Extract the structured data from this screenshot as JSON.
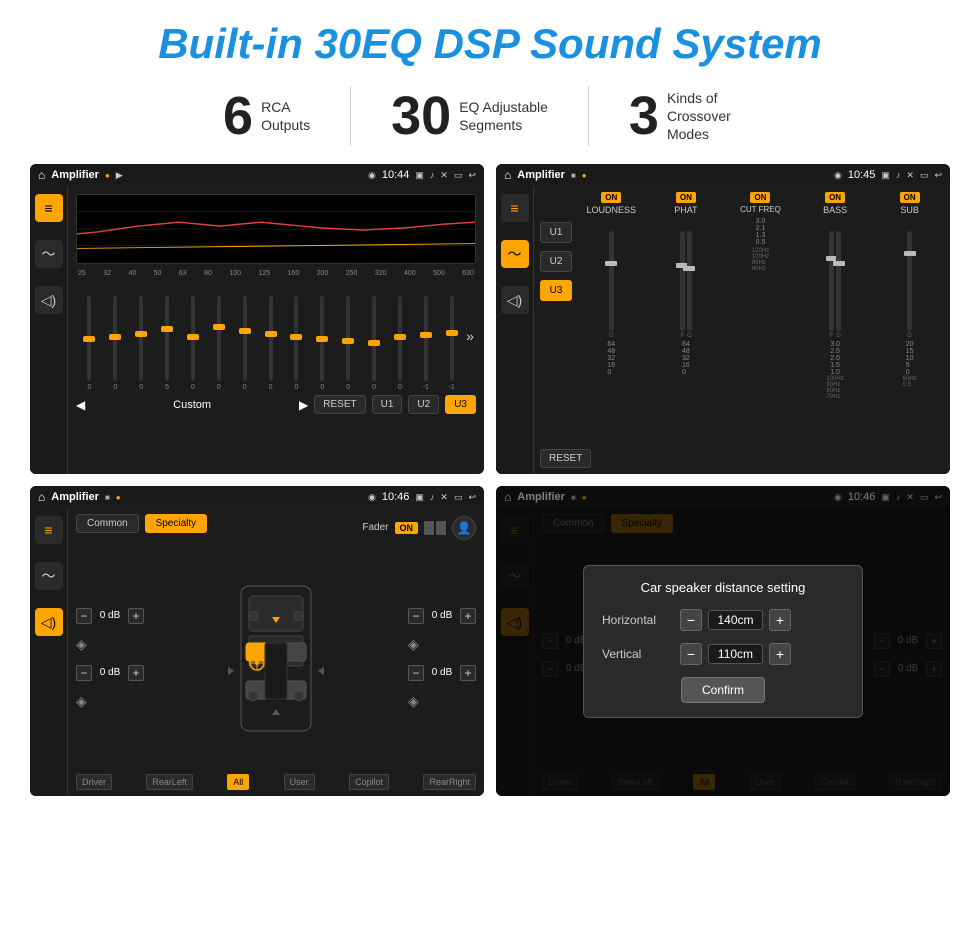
{
  "page": {
    "title": "Built-in 30EQ DSP Sound System",
    "stats": [
      {
        "number": "6",
        "text_line1": "RCA",
        "text_line2": "Outputs"
      },
      {
        "number": "30",
        "text_line1": "EQ Adjustable",
        "text_line2": "Segments"
      },
      {
        "number": "3",
        "text_line1": "Kinds of",
        "text_line2": "Crossover Modes"
      }
    ]
  },
  "screens": {
    "eq": {
      "topbar": {
        "title": "Amplifier",
        "time": "10:44"
      },
      "freq_labels": [
        "25",
        "32",
        "40",
        "50",
        "63",
        "80",
        "100",
        "125",
        "160",
        "200",
        "250",
        "320",
        "400",
        "500",
        "630"
      ],
      "preset_label": "Custom",
      "buttons": [
        "RESET",
        "U1",
        "U2",
        "U3"
      ]
    },
    "dsp": {
      "topbar": {
        "title": "Amplifier",
        "time": "10:45"
      },
      "presets": [
        "U1",
        "U2",
        "U3"
      ],
      "active_preset": "U3",
      "channels": [
        {
          "name": "LOUDNESS",
          "on": true
        },
        {
          "name": "PHAT",
          "on": true
        },
        {
          "name": "CUT FREQ",
          "on": true
        },
        {
          "name": "BASS",
          "on": true
        },
        {
          "name": "SUB",
          "on": true
        }
      ],
      "reset_label": "RESET"
    },
    "fader": {
      "topbar": {
        "title": "Amplifier",
        "time": "10:46"
      },
      "tabs": [
        "Common",
        "Specialty"
      ],
      "active_tab": "Specialty",
      "fader_label": "Fader",
      "on_badge": "ON",
      "db_values": [
        "0 dB",
        "0 dB",
        "0 dB",
        "0 dB"
      ],
      "position_labels": [
        "Driver",
        "RearLeft",
        "All",
        "User",
        "Copilot",
        "RearRight"
      ]
    },
    "dialog": {
      "topbar": {
        "title": "Amplifier",
        "time": "10:46"
      },
      "tabs": [
        "Common",
        "Specialty"
      ],
      "active_tab": "Specialty",
      "dialog": {
        "title": "Car speaker distance setting",
        "rows": [
          {
            "label": "Horizontal",
            "value": "140cm"
          },
          {
            "label": "Vertical",
            "value": "110cm"
          }
        ],
        "confirm_label": "Confirm"
      },
      "db_values": [
        "0 dB",
        "0 dB"
      ],
      "position_labels": [
        "Driver",
        "RearLeft",
        "All",
        "User",
        "Copilot",
        "RearRight"
      ]
    }
  },
  "icons": {
    "home": "⌂",
    "equalizer": "≡",
    "waveform": "〜",
    "speaker": "◁)",
    "settings": "⚙",
    "camera": "📷",
    "back": "↩",
    "location": "◉",
    "volume": "♪",
    "close_x": "✕",
    "window": "▭",
    "signal": "▲",
    "person": "👤",
    "minus": "−",
    "plus": "+"
  }
}
